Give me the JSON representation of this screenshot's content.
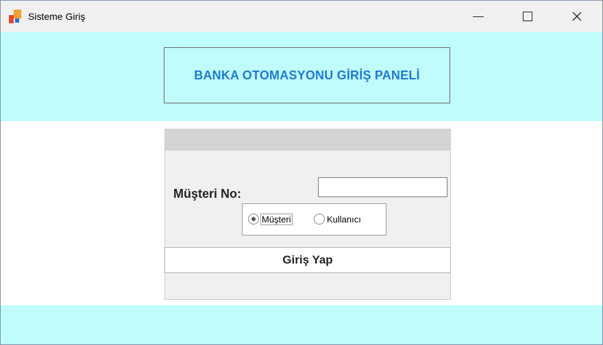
{
  "window": {
    "title": "Sisteme Giriş",
    "icon": "app-icon",
    "controls": {
      "minimize": "minimize-icon",
      "maximize": "maximize-icon",
      "close": "close-icon"
    }
  },
  "header": {
    "title": "BANKA OTOMASYONU GİRİŞ PANELİ"
  },
  "login": {
    "customer_no_label": "Müşteri No:",
    "customer_no_value": "",
    "role_options": [
      {
        "label": "Müşteri",
        "selected": true
      },
      {
        "label": "Kullanıcı",
        "selected": false
      }
    ],
    "submit_label": "Giriş Yap"
  },
  "colors": {
    "banner": "#c0fcfc",
    "title_blue": "#1e7bd3",
    "panel_bg": "#f0f0f0"
  }
}
